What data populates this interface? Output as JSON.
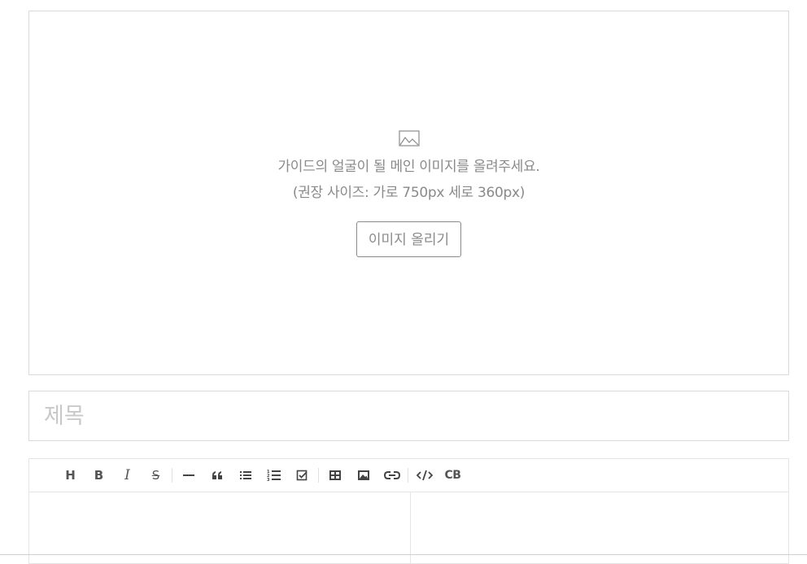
{
  "upload": {
    "icon": "image-icon",
    "line1": "가이드의 얼굴이 될 메인 이미지를 올려주세요.",
    "line2": "(권장 사이즈: 가로 750px 세로 360px)",
    "button_label": "이미지 올리기"
  },
  "title_field": {
    "placeholder": "제목",
    "value": ""
  },
  "editor": {
    "toolbar": [
      {
        "name": "heading-button",
        "label": "H",
        "icon": "heading-icon"
      },
      {
        "name": "bold-button",
        "label": "B",
        "icon": "bold-icon"
      },
      {
        "name": "italic-button",
        "label": "I",
        "icon": "italic-icon"
      },
      {
        "name": "strike-button",
        "label": "S",
        "icon": "strike-icon"
      },
      {
        "name": "horizontal-rule-button",
        "icon": "horizontal-rule-icon"
      },
      {
        "name": "quote-button",
        "icon": "quote-icon"
      },
      {
        "name": "bullet-list-button",
        "icon": "bullet-list-icon"
      },
      {
        "name": "ordered-list-button",
        "icon": "ordered-list-icon"
      },
      {
        "name": "task-list-button",
        "icon": "task-list-icon"
      },
      {
        "name": "table-button",
        "icon": "table-icon"
      },
      {
        "name": "image-button",
        "icon": "image-icon"
      },
      {
        "name": "link-button",
        "icon": "link-icon"
      },
      {
        "name": "code-button",
        "icon": "code-icon"
      },
      {
        "name": "codeblock-button",
        "label": "CB",
        "icon": "codeblock-icon"
      }
    ],
    "markdown_content": "",
    "preview_content": ""
  }
}
